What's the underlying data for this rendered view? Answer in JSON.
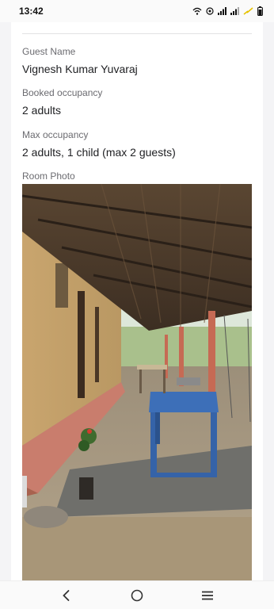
{
  "status_bar": {
    "time": "13:42",
    "icons": [
      "wifi-calling-icon",
      "hotspot-icon",
      "signal-icon",
      "signal-icon",
      "charging-icon",
      "battery-icon"
    ]
  },
  "booking": {
    "guest_name_label": "Guest Name",
    "guest_name": "Vignesh Kumar Yuvaraj",
    "booked_occupancy_label": "Booked occupancy",
    "booked_occupancy": "2 adults",
    "max_occupancy_label": "Max occupancy",
    "max_occupancy": "2 adults, 1 child (max 2 guests)",
    "room_photo_label": "Room Photo"
  },
  "nav_bar": {
    "buttons": [
      "back-icon",
      "home-icon",
      "recents-icon"
    ]
  }
}
